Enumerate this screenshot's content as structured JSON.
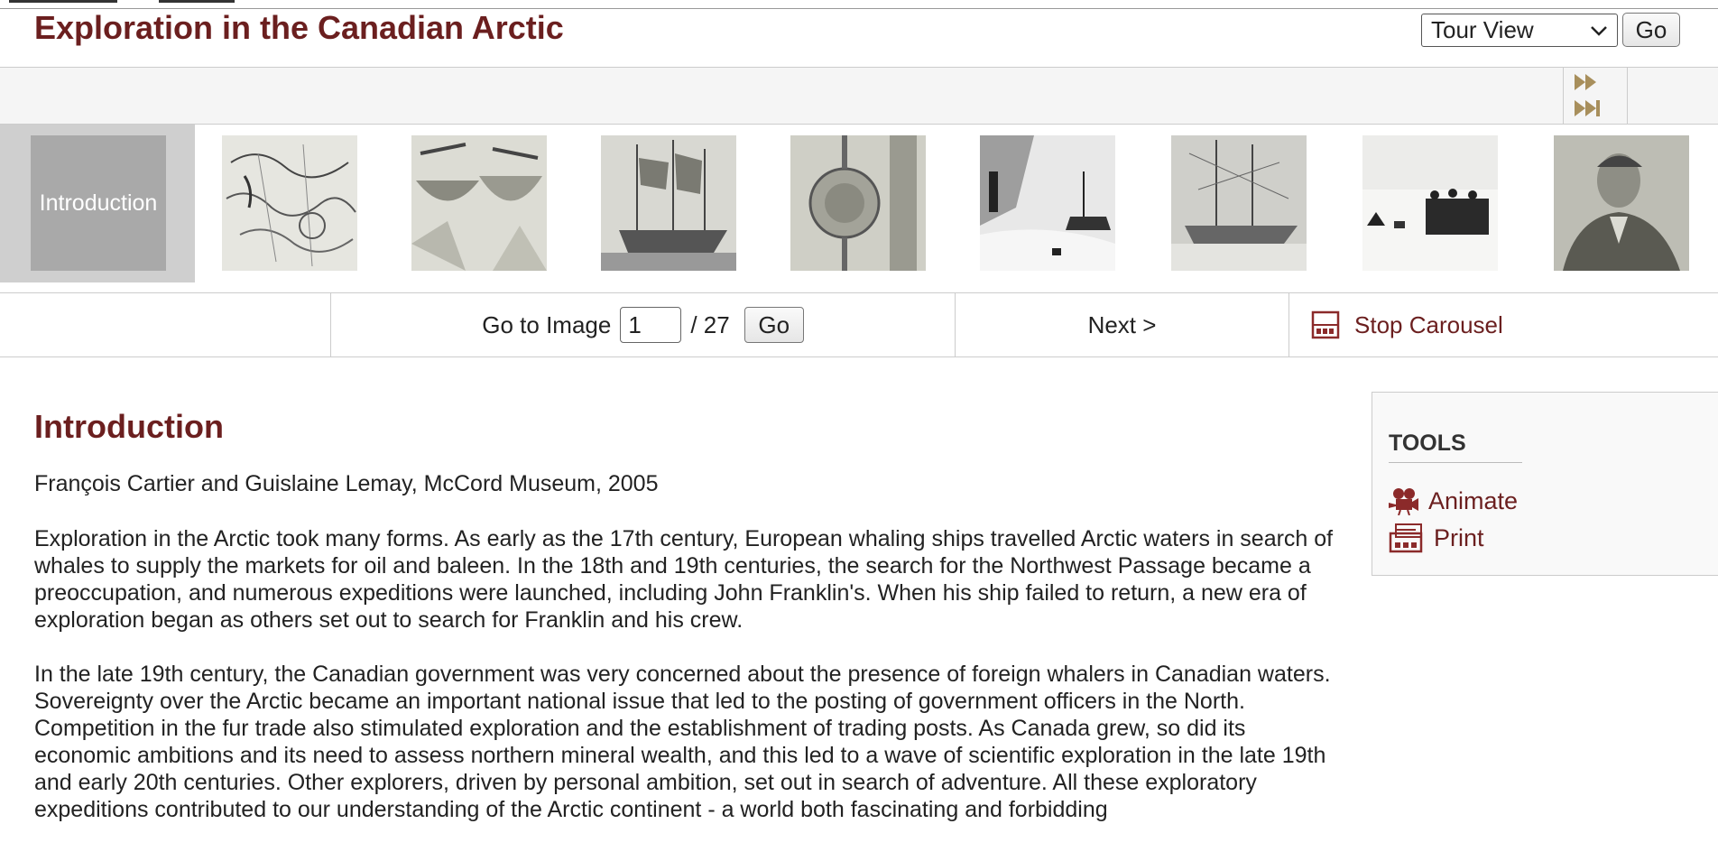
{
  "header": {
    "title": "Exploration in the Canadian Arctic",
    "view_select_value": "Tour View",
    "go_label": "Go"
  },
  "carousel": {
    "intro_label": "Introduction",
    "thumbnails": [
      {
        "name": "thumb-map",
        "icon": "arctic-map-image"
      },
      {
        "name": "thumb-boats",
        "icon": "whaling-boats-image"
      },
      {
        "name": "thumb-ships",
        "icon": "sailing-ship-image"
      },
      {
        "name": "thumb-ornament",
        "icon": "ornament-image"
      },
      {
        "name": "thumb-ice-photo",
        "icon": "ice-photo-image"
      },
      {
        "name": "thumb-ship-in-ice",
        "icon": "ship-in-ice-image"
      },
      {
        "name": "thumb-sledge-party",
        "icon": "sledge-party-image"
      },
      {
        "name": "thumb-portrait",
        "icon": "portrait-image"
      }
    ]
  },
  "navigation": {
    "goto_label": "Go to Image",
    "current_image": "1",
    "total_label": "/ 27",
    "go_label": "Go",
    "next_label": "Next >",
    "stop_label": "Stop Carousel"
  },
  "content": {
    "heading": "Introduction",
    "byline": "François Cartier and Guislaine Lemay, McCord Museum, 2005",
    "paragraph1": "Exploration in the Arctic took many forms. As early as the 17th century, European whaling ships travelled Arctic waters in search of whales to supply the markets for oil and baleen. In the 18th and 19th centuries, the search for the Northwest Passage became a preoccupation, and numerous expeditions were launched, including John Franklin's. When his ship failed to return, a new era of exploration began as others set out to search for Franklin and his crew.",
    "paragraph2": "In the late 19th century, the Canadian government was very concerned about the presence of foreign whalers in Canadian waters. Sovereignty over the Arctic became an important national issue that led to the posting of government officers in the North. Competition in the fur trade also stimulated exploration and the establishment of trading posts. As Canada grew, so did its economic ambitions and its need to assess northern mineral wealth, and this led to a wave of scientific exploration in the late 19th and early 20th centuries. Other explorers, driven by personal ambition, set out in search of adventure. All these exploratory expeditions contributed to our understanding of the Arctic continent - a world both fascinating and forbidding"
  },
  "tools": {
    "title": "TOOLS",
    "animate_label": "Animate",
    "print_label": "Print"
  },
  "colors": {
    "accent": "#6b1f1f",
    "border": "#cccccc"
  }
}
